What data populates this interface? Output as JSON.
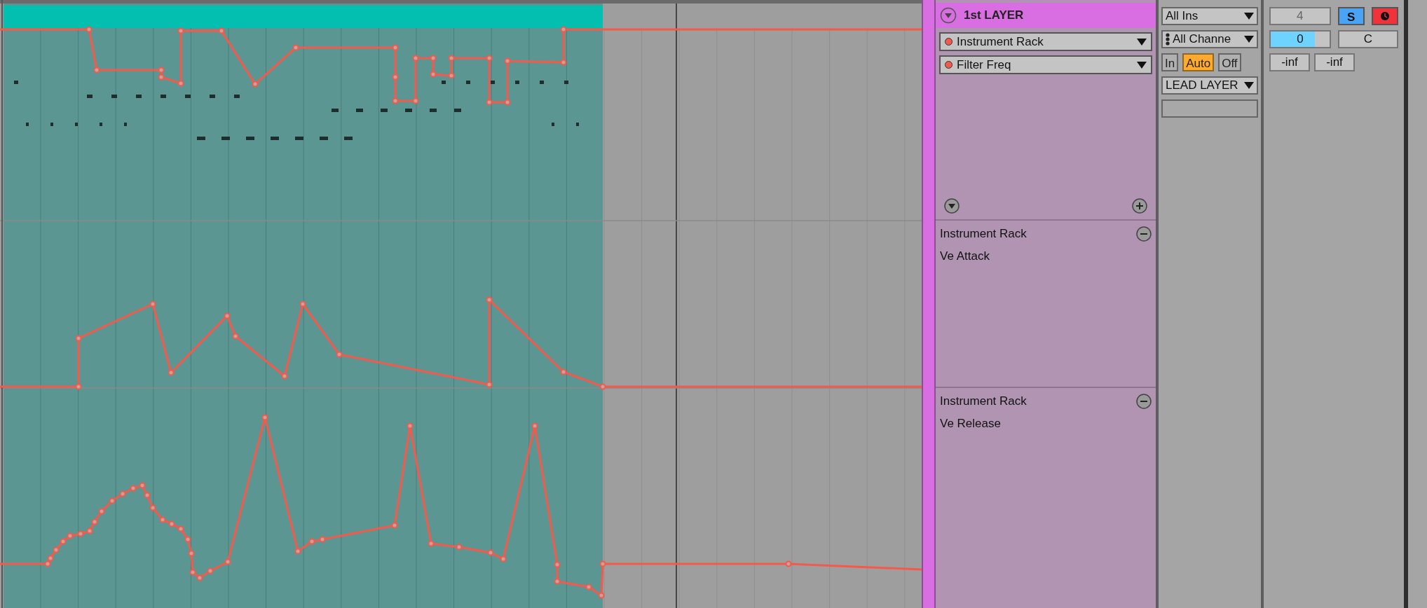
{
  "track": {
    "name": "1st LAYER",
    "device": "Instrument Rack",
    "parameter": "Filter Freq"
  },
  "lanes": [
    {
      "device": "Instrument Rack",
      "parameter": "Ve Attack"
    },
    {
      "device": "Instrument Rack",
      "parameter": "Ve Release"
    }
  ],
  "io": {
    "input_type": "All Ins",
    "input_channel": "All Channe",
    "monitor": [
      {
        "label": "In",
        "selected": false
      },
      {
        "label": "Auto",
        "selected": true
      },
      {
        "label": "Off",
        "selected": false
      }
    ],
    "output": "LEAD LAYER"
  },
  "mixer": {
    "track_number": "4",
    "solo": {
      "label": "S",
      "on": true
    },
    "arm": {
      "on": true
    },
    "volume": {
      "value": "0",
      "level": 0.75
    },
    "pan": "C",
    "meters": [
      "-inf",
      "-inf"
    ]
  }
}
